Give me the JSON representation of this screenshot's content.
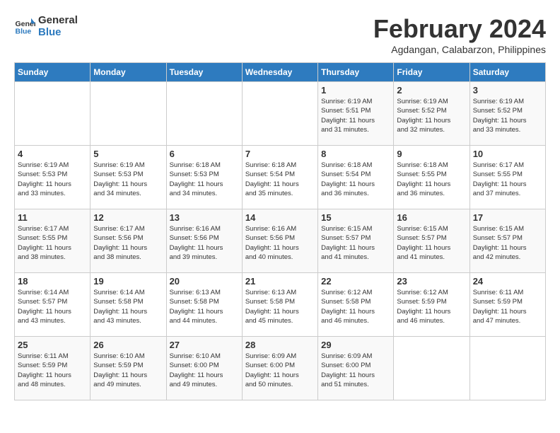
{
  "logo": {
    "line1": "General",
    "line2": "Blue"
  },
  "title": "February 2024",
  "location": "Agdangan, Calabarzon, Philippines",
  "weekdays": [
    "Sunday",
    "Monday",
    "Tuesday",
    "Wednesday",
    "Thursday",
    "Friday",
    "Saturday"
  ],
  "weeks": [
    [
      {
        "day": "",
        "info": ""
      },
      {
        "day": "",
        "info": ""
      },
      {
        "day": "",
        "info": ""
      },
      {
        "day": "",
        "info": ""
      },
      {
        "day": "1",
        "info": "Sunrise: 6:19 AM\nSunset: 5:51 PM\nDaylight: 11 hours\nand 31 minutes."
      },
      {
        "day": "2",
        "info": "Sunrise: 6:19 AM\nSunset: 5:52 PM\nDaylight: 11 hours\nand 32 minutes."
      },
      {
        "day": "3",
        "info": "Sunrise: 6:19 AM\nSunset: 5:52 PM\nDaylight: 11 hours\nand 33 minutes."
      }
    ],
    [
      {
        "day": "4",
        "info": "Sunrise: 6:19 AM\nSunset: 5:53 PM\nDaylight: 11 hours\nand 33 minutes."
      },
      {
        "day": "5",
        "info": "Sunrise: 6:19 AM\nSunset: 5:53 PM\nDaylight: 11 hours\nand 34 minutes."
      },
      {
        "day": "6",
        "info": "Sunrise: 6:18 AM\nSunset: 5:53 PM\nDaylight: 11 hours\nand 34 minutes."
      },
      {
        "day": "7",
        "info": "Sunrise: 6:18 AM\nSunset: 5:54 PM\nDaylight: 11 hours\nand 35 minutes."
      },
      {
        "day": "8",
        "info": "Sunrise: 6:18 AM\nSunset: 5:54 PM\nDaylight: 11 hours\nand 36 minutes."
      },
      {
        "day": "9",
        "info": "Sunrise: 6:18 AM\nSunset: 5:55 PM\nDaylight: 11 hours\nand 36 minutes."
      },
      {
        "day": "10",
        "info": "Sunrise: 6:17 AM\nSunset: 5:55 PM\nDaylight: 11 hours\nand 37 minutes."
      }
    ],
    [
      {
        "day": "11",
        "info": "Sunrise: 6:17 AM\nSunset: 5:55 PM\nDaylight: 11 hours\nand 38 minutes."
      },
      {
        "day": "12",
        "info": "Sunrise: 6:17 AM\nSunset: 5:56 PM\nDaylight: 11 hours\nand 38 minutes."
      },
      {
        "day": "13",
        "info": "Sunrise: 6:16 AM\nSunset: 5:56 PM\nDaylight: 11 hours\nand 39 minutes."
      },
      {
        "day": "14",
        "info": "Sunrise: 6:16 AM\nSunset: 5:56 PM\nDaylight: 11 hours\nand 40 minutes."
      },
      {
        "day": "15",
        "info": "Sunrise: 6:15 AM\nSunset: 5:57 PM\nDaylight: 11 hours\nand 41 minutes."
      },
      {
        "day": "16",
        "info": "Sunrise: 6:15 AM\nSunset: 5:57 PM\nDaylight: 11 hours\nand 41 minutes."
      },
      {
        "day": "17",
        "info": "Sunrise: 6:15 AM\nSunset: 5:57 PM\nDaylight: 11 hours\nand 42 minutes."
      }
    ],
    [
      {
        "day": "18",
        "info": "Sunrise: 6:14 AM\nSunset: 5:57 PM\nDaylight: 11 hours\nand 43 minutes."
      },
      {
        "day": "19",
        "info": "Sunrise: 6:14 AM\nSunset: 5:58 PM\nDaylight: 11 hours\nand 43 minutes."
      },
      {
        "day": "20",
        "info": "Sunrise: 6:13 AM\nSunset: 5:58 PM\nDaylight: 11 hours\nand 44 minutes."
      },
      {
        "day": "21",
        "info": "Sunrise: 6:13 AM\nSunset: 5:58 PM\nDaylight: 11 hours\nand 45 minutes."
      },
      {
        "day": "22",
        "info": "Sunrise: 6:12 AM\nSunset: 5:58 PM\nDaylight: 11 hours\nand 46 minutes."
      },
      {
        "day": "23",
        "info": "Sunrise: 6:12 AM\nSunset: 5:59 PM\nDaylight: 11 hours\nand 46 minutes."
      },
      {
        "day": "24",
        "info": "Sunrise: 6:11 AM\nSunset: 5:59 PM\nDaylight: 11 hours\nand 47 minutes."
      }
    ],
    [
      {
        "day": "25",
        "info": "Sunrise: 6:11 AM\nSunset: 5:59 PM\nDaylight: 11 hours\nand 48 minutes."
      },
      {
        "day": "26",
        "info": "Sunrise: 6:10 AM\nSunset: 5:59 PM\nDaylight: 11 hours\nand 49 minutes."
      },
      {
        "day": "27",
        "info": "Sunrise: 6:10 AM\nSunset: 6:00 PM\nDaylight: 11 hours\nand 49 minutes."
      },
      {
        "day": "28",
        "info": "Sunrise: 6:09 AM\nSunset: 6:00 PM\nDaylight: 11 hours\nand 50 minutes."
      },
      {
        "day": "29",
        "info": "Sunrise: 6:09 AM\nSunset: 6:00 PM\nDaylight: 11 hours\nand 51 minutes."
      },
      {
        "day": "",
        "info": ""
      },
      {
        "day": "",
        "info": ""
      }
    ]
  ]
}
